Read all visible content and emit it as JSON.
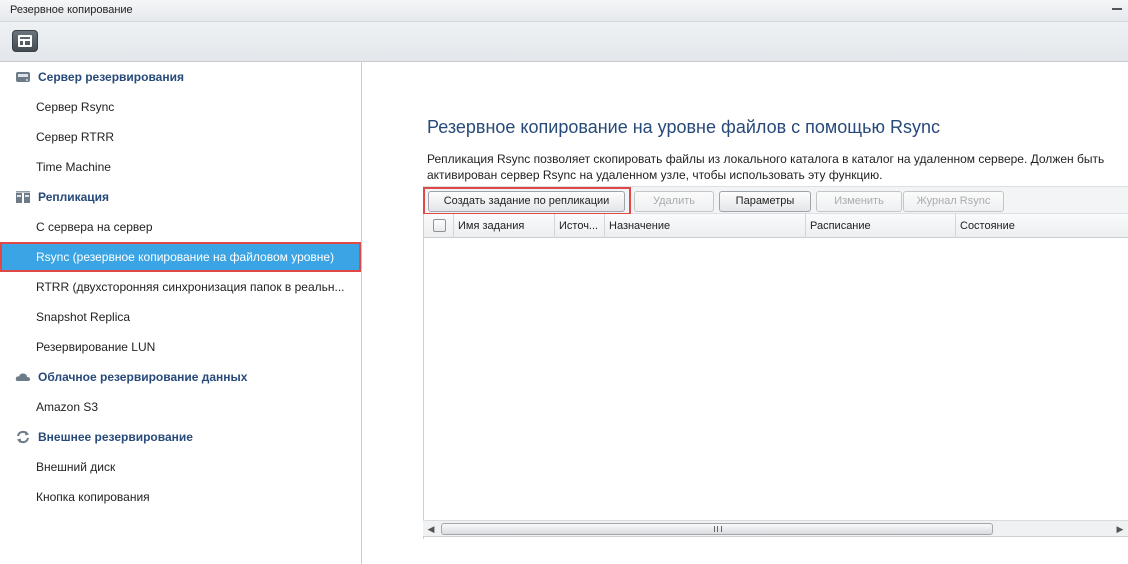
{
  "window": {
    "title": "Резервное копирование"
  },
  "toolbar": {
    "layout_button_icon": "layout-icon"
  },
  "sidebar": {
    "groups": [
      {
        "label": "Сервер резервирования",
        "icon": "server-icon",
        "items": [
          "Сервер Rsync",
          "Сервер RTRR",
          "Time Machine"
        ]
      },
      {
        "label": "Репликация",
        "icon": "replication-icon",
        "items": [
          "С сервера на сервер",
          "Rsync (резервное копирование на файловом уровне)",
          "RTRR (двухсторонняя синхронизация папок в реальн...",
          "Snapshot Replica",
          "Резервирование LUN"
        ]
      },
      {
        "label": "Облачное резервирование данных",
        "icon": "cloud-icon",
        "items": [
          "Amazon S3"
        ]
      },
      {
        "label": "Внешнее резервирование",
        "icon": "sync-icon",
        "items": [
          "Внешний диск",
          "Кнопка копирования"
        ]
      }
    ],
    "active_item": "Rsync (резервное копирование на файловом уровне)"
  },
  "main": {
    "heading": "Резервное копирование на уровне файлов с помощью Rsync",
    "description": "Репликация Rsync позволяет скопировать файлы из локального каталога в каталог на удаленном сервере. Должен быть активирован сервер Rsync на удаленном узле, чтобы использовать эту функцию.",
    "buttons": {
      "create": "Создать задание по репликации",
      "delete": "Удалить",
      "params": "Параметры",
      "edit": "Изменить",
      "log": "Журнал Rsync"
    },
    "columns": [
      "Имя задания",
      "Источ...",
      "Назначение",
      "Расписание",
      "Состояние"
    ]
  },
  "colors": {
    "accent": "#3aa4e4",
    "heading": "#274a7a",
    "highlight": "#e04848"
  }
}
